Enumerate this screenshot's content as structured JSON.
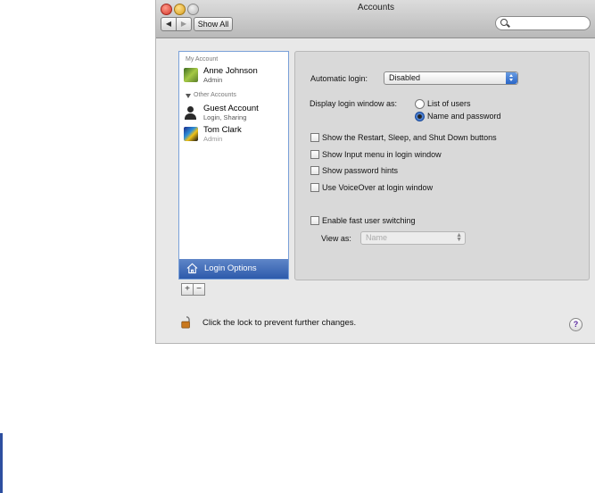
{
  "window": {
    "title": "Accounts"
  },
  "toolbar": {
    "back": "◀",
    "forward": "▶",
    "show_all": "Show All",
    "search_placeholder": ""
  },
  "sidebar": {
    "my_account_header": "My Account",
    "my_account": {
      "name": "Anne Johnson",
      "role": "Admin"
    },
    "other_header": "Other Accounts",
    "others": [
      {
        "name": "Guest Account",
        "role": "Login, Sharing"
      },
      {
        "name": "Tom Clark",
        "role": "Admin"
      }
    ],
    "login_options": "Login Options",
    "add": "+",
    "remove": "−"
  },
  "options": {
    "auto_login_label": "Automatic login:",
    "auto_login_value": "Disabled",
    "display_label": "Display login window as:",
    "radio_list": "List of users",
    "radio_name": "Name and password",
    "cb_restart": "Show the Restart, Sleep, and Shut Down buttons",
    "cb_input_menu": "Show Input menu in login window",
    "cb_hints": "Show password hints",
    "cb_voiceover": "Use VoiceOver at login window",
    "cb_fast_switch": "Enable fast user switching",
    "view_as_label": "View as:",
    "view_as_value": "Name"
  },
  "footer": {
    "lock_text": "Click the lock to prevent further changes.",
    "help": "?"
  }
}
